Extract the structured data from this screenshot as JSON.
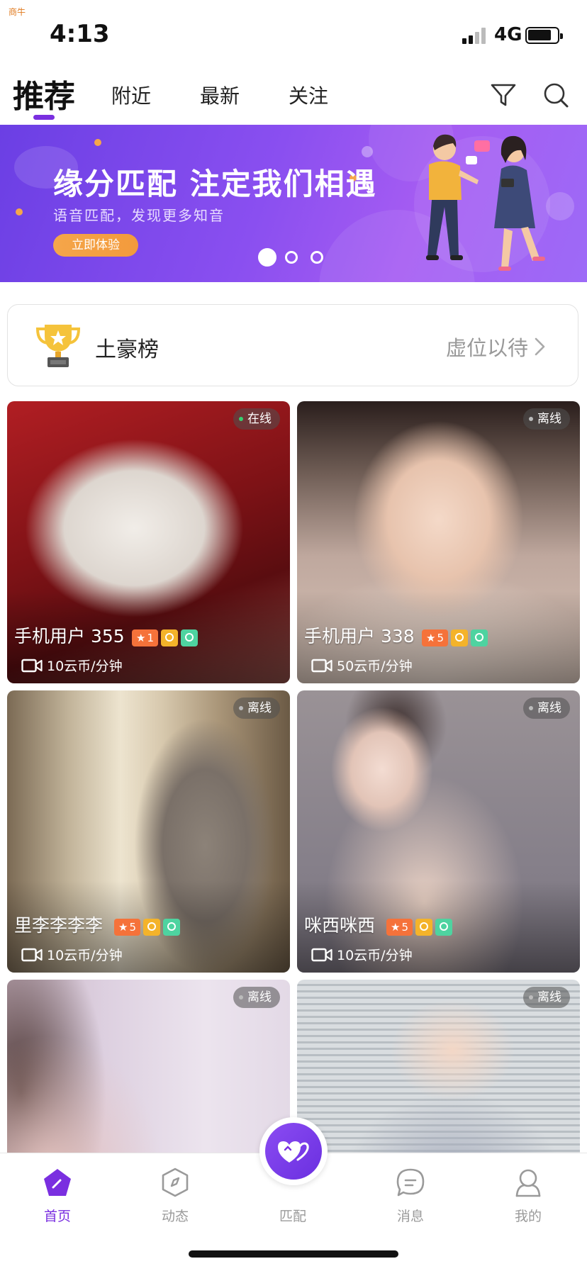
{
  "watermark": "商牛",
  "status_bar": {
    "time": "4:13",
    "network": "4G"
  },
  "top_nav": {
    "tabs": [
      {
        "label": "推荐",
        "active": true
      },
      {
        "label": "附近",
        "active": false
      },
      {
        "label": "最新",
        "active": false
      },
      {
        "label": "关注",
        "active": false
      }
    ],
    "icons": [
      "filter-icon",
      "search-icon"
    ],
    "accent_color": "#7a2fe0"
  },
  "banner": {
    "title": "缘分匹配 注定我们相遇",
    "subtitle": "语音匹配，发现更多知音",
    "button_label": "立即体验",
    "slide_count": 3,
    "active_slide": 1
  },
  "rank_card": {
    "title": "土豪榜",
    "right_text": "虚位以待"
  },
  "users": [
    {
      "name": "手机用户 355",
      "status": "在线",
      "level": "1",
      "price": "10云币/分钟",
      "online": true
    },
    {
      "name": "手机用户 338",
      "status": "离线",
      "level": "5",
      "price": "50云币/分钟",
      "online": false
    },
    {
      "name": "里李李李李",
      "status": "离线",
      "level": "5",
      "price": "10云币/分钟",
      "online": false
    },
    {
      "name": "咪西咪西",
      "status": "离线",
      "level": "5",
      "price": "10云币/分钟",
      "online": false
    },
    {
      "name": "",
      "status": "离线",
      "level": "",
      "price": "",
      "online": false
    },
    {
      "name": "",
      "status": "离线",
      "level": "",
      "price": "",
      "online": false
    }
  ],
  "tab_bar": {
    "items": [
      {
        "label": "首页",
        "icon": "home-icon",
        "active": true
      },
      {
        "label": "动态",
        "icon": "compass-icon",
        "active": false
      },
      {
        "label": "匹配",
        "icon": "hearts-icon",
        "active": false
      },
      {
        "label": "消息",
        "icon": "message-icon",
        "active": false
      },
      {
        "label": "我的",
        "icon": "profile-icon",
        "active": false
      }
    ]
  }
}
